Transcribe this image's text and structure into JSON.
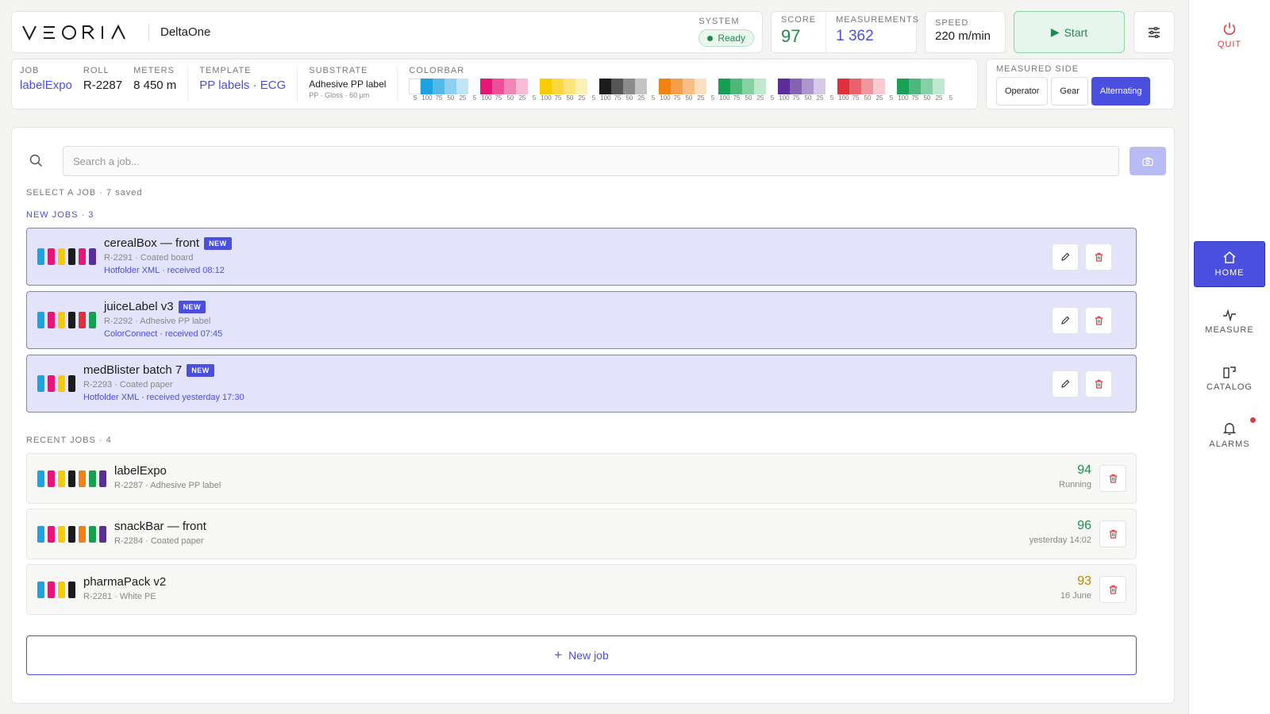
{
  "header": {
    "brand": "VEORIA",
    "product": "DeltaOne",
    "system_label": "SYSTEM",
    "system_status": "Ready",
    "score_label": "SCORE",
    "score_value": "97",
    "measurements_label": "MEASUREMENTS",
    "measurements_value": "1 362",
    "speed_label": "SPEED",
    "speed_value": "220 m/min",
    "start_label": "Start"
  },
  "info": {
    "job_label": "JOB",
    "job_value": "labelExpo",
    "roll_label": "ROLL",
    "roll_value": "R-2287",
    "meters_label": "METERS",
    "meters_value": "8 450 m",
    "template_label": "TEMPLATE",
    "template_value": "PP labels · ECG",
    "substrate_label": "SUBSTRATE",
    "substrate_value": "Adhesive PP label",
    "substrate_sub": "PP · Gloss · 60 µm",
    "colorbar_label": "COLORBAR",
    "colorbar_first_label": "S",
    "colorbar_groups": [
      {
        "colors": [
          "#1aa3e0",
          "#53b9e8",
          "#8ccfee",
          "#c2e5f6"
        ],
        "labels": [
          "100",
          "75",
          "50",
          "25"
        ]
      },
      {
        "colors": [
          "#e5157a",
          "#ec4f98",
          "#f286b7",
          "#f8bcd6"
        ],
        "labels": [
          "100",
          "75",
          "50",
          "25"
        ]
      },
      {
        "colors": [
          "#f7cc00",
          "#f9d93f",
          "#fbe47a",
          "#fdf0b6"
        ],
        "labels": [
          "100",
          "75",
          "50",
          "25"
        ]
      },
      {
        "colors": [
          "#1c1c1c",
          "#555555",
          "#8c8c8c",
          "#c4c4c4"
        ],
        "labels": [
          "100",
          "75",
          "50",
          "25"
        ]
      },
      {
        "colors": [
          "#f08212",
          "#f3a04c",
          "#f7bf86",
          "#fbdfc1"
        ],
        "labels": [
          "100",
          "75",
          "50",
          "25"
        ]
      },
      {
        "colors": [
          "#14a050",
          "#4db878",
          "#86d0a1",
          "#c1e8cd"
        ],
        "labels": [
          "100",
          "75",
          "50",
          "25"
        ]
      },
      {
        "colors": [
          "#5b2d9a",
          "#8461b3",
          "#ad95cd",
          "#d6cae6"
        ],
        "labels": [
          "100",
          "75",
          "50",
          "25"
        ]
      },
      {
        "colors": [
          "#e0303c",
          "#e7646d",
          "#ef979e",
          "#f7cbcf"
        ],
        "labels": [
          "100",
          "75",
          "50",
          "25"
        ]
      },
      {
        "colors": [
          "#1aa055",
          "#4db87e",
          "#86d0a7",
          "#c1e8d3"
        ],
        "labels": [
          "100",
          "75",
          "50",
          "25"
        ]
      }
    ],
    "colorbar_sep_label": "5"
  },
  "measured_side": {
    "label": "MEASURED SIDE",
    "options": [
      "Operator",
      "Gear",
      "Alternating"
    ],
    "selected": "Alternating"
  },
  "search": {
    "placeholder": "Search a job..."
  },
  "select_caption": "SELECT A JOB · 7 saved",
  "new_jobs_caption": "NEW JOBS · 3",
  "recent_jobs_caption": "RECENT JOBS · 4",
  "new_jobs": [
    {
      "name": "cerealBox — front",
      "badge": "NEW",
      "sub": "R-2291 · Coated board",
      "source": "Hotfolder XML · received 08:12",
      "colors": [
        "#1aa3e0",
        "#e5157a",
        "#f7cc00",
        "#1c1c1c",
        "#e5157a",
        "#5b2d9a"
      ]
    },
    {
      "name": "juiceLabel v3",
      "badge": "NEW",
      "sub": "R-2292 · Adhesive PP label",
      "source": "ColorConnect · received 07:45",
      "colors": [
        "#1aa3e0",
        "#e5157a",
        "#f7cc00",
        "#1c1c1c",
        "#e0303c",
        "#14a050"
      ]
    },
    {
      "name": "medBlister batch 7",
      "badge": "NEW",
      "sub": "R-2293 · Coated paper",
      "source": "Hotfolder XML · received yesterday 17:30",
      "colors": [
        "#1aa3e0",
        "#e5157a",
        "#f7cc00",
        "#1c1c1c"
      ]
    }
  ],
  "recent_jobs": [
    {
      "name": "labelExpo",
      "sub": "R-2287 · Adhesive PP label",
      "score": "94",
      "score_color": "#1f8a4c",
      "status": "Running",
      "colors": [
        "#1aa3e0",
        "#e5157a",
        "#f7cc00",
        "#1c1c1c",
        "#f08212",
        "#14a050",
        "#5b2d9a"
      ]
    },
    {
      "name": "snackBar — front",
      "sub": "R-2284 · Coated paper",
      "score": "96",
      "score_color": "#1f8a4c",
      "status": "yesterday 14:02",
      "colors": [
        "#1aa3e0",
        "#e5157a",
        "#f7cc00",
        "#1c1c1c",
        "#f08212",
        "#14a050",
        "#5b2d9a"
      ]
    },
    {
      "name": "pharmaPack v2",
      "sub": "R-2281 · White PE",
      "score": "93",
      "score_color": "#b8860b",
      "status": "16 June",
      "colors": [
        "#1aa3e0",
        "#e5157a",
        "#f7cc00",
        "#1c1c1c"
      ]
    }
  ],
  "new_job_label": "New job",
  "nav": {
    "quit": "QUIT",
    "home": "HOME",
    "measure": "MEASURE",
    "catalog": "CATALOG",
    "alarms": "ALARMS"
  },
  "colors": {
    "accent": "#4a4fe0",
    "success": "#1f8a4c",
    "danger": "#e03b3b"
  }
}
